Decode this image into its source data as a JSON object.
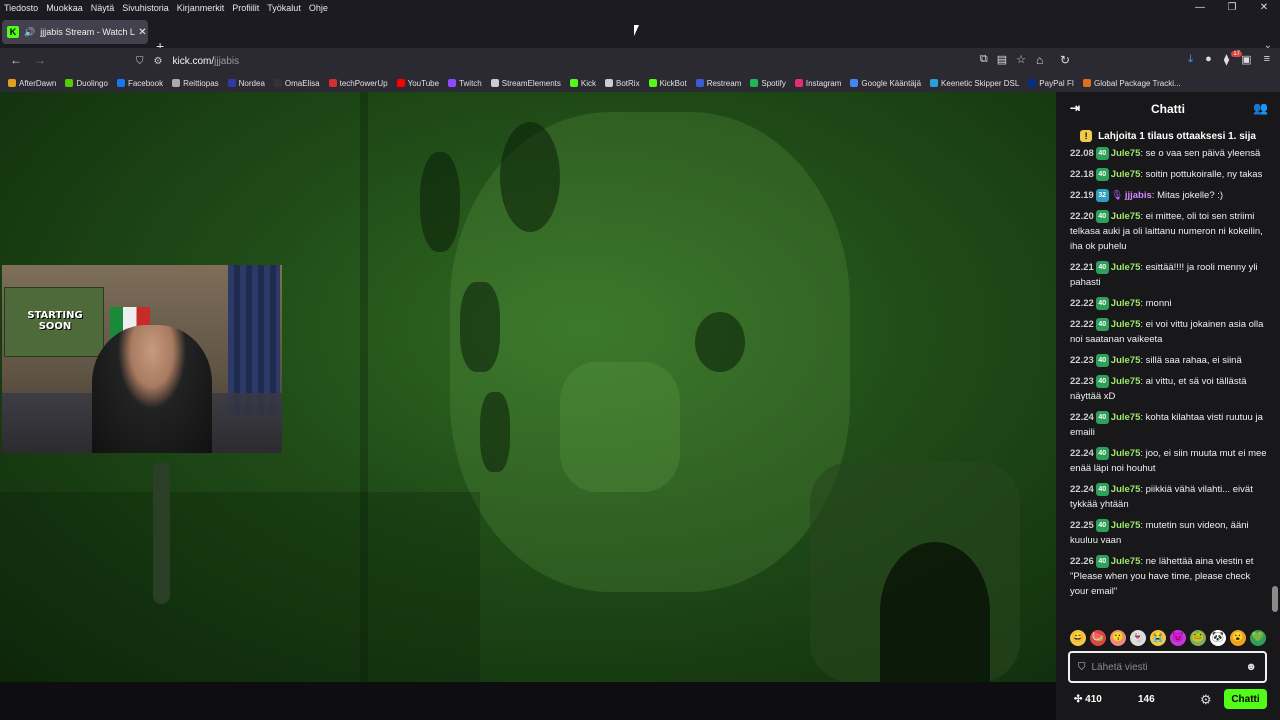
{
  "menubar": {
    "items": [
      "Tiedosto",
      "Muokkaa",
      "Näytä",
      "Sivuhistoria",
      "Kirjanmerkit",
      "Profiilit",
      "Työkalut",
      "Ohje"
    ]
  },
  "tab": {
    "title": "jjjabis Stream - Watch Live",
    "favicon": "K"
  },
  "url": {
    "host": "kick.com/",
    "path": "jjjabis"
  },
  "toolbar": {
    "extension_badge": "17"
  },
  "bookmarks": [
    {
      "label": "AfterDawn",
      "color": "#e0a020"
    },
    {
      "label": "Duolingo",
      "color": "#58cc02"
    },
    {
      "label": "Facebook",
      "color": "#1877f2"
    },
    {
      "label": "Reittiopas",
      "color": "#aaaaaa"
    },
    {
      "label": "Nordea",
      "color": "#2d3aa8"
    },
    {
      "label": "OmaElisa",
      "color": "#333333"
    },
    {
      "label": "techPowerUp",
      "color": "#d03030"
    },
    {
      "label": "YouTube",
      "color": "#ff0000"
    },
    {
      "label": "Twitch",
      "color": "#9146ff"
    },
    {
      "label": "StreamElements",
      "color": "#cccccc"
    },
    {
      "label": "Kick",
      "color": "#53fc18"
    },
    {
      "label": "BotRix",
      "color": "#cccccc"
    },
    {
      "label": "KickBot",
      "color": "#53fc18"
    },
    {
      "label": "Restream",
      "color": "#3a5bd8"
    },
    {
      "label": "Spotify",
      "color": "#1db954"
    },
    {
      "label": "Instagram",
      "color": "#e1306c"
    },
    {
      "label": "Google Kääntäjä",
      "color": "#4285f4"
    },
    {
      "label": "Keenetic Skipper DSL",
      "color": "#2aa0d8"
    },
    {
      "label": "PayPal FI",
      "color": "#003087"
    },
    {
      "label": "Global Package Tracki...",
      "color": "#e07020"
    }
  ],
  "cam": {
    "poster_text": "STARTING SOON"
  },
  "chat": {
    "title": "Chatti",
    "pinned": "Lahjoita 1 tilaus ottaaksesi 1. sija",
    "messages": [
      {
        "time": "22.08",
        "badge": "40",
        "user": "Jule75",
        "text": "se o vaa sen päivä yleensä"
      },
      {
        "time": "22.18",
        "badge": "40",
        "user": "Jule75",
        "text": "soitin pottukoiralle, ny takas"
      },
      {
        "time": "22.19",
        "badge": "32",
        "user": "jjjabis",
        "text": "Mitas jokelle? :)"
      },
      {
        "time": "22.20",
        "badge": "40",
        "user": "Jule75",
        "text": "ei mittee, oli toi sen striimi telkasa auki ja oli laittanu numeron ni kokeilin, iha ok puhelu"
      },
      {
        "time": "22.21",
        "badge": "40",
        "user": "Jule75",
        "text": "esittää!!!! ja rooli menny yli pahasti"
      },
      {
        "time": "22.22",
        "badge": "40",
        "user": "Jule75",
        "text": "monni"
      },
      {
        "time": "22.22",
        "badge": "40",
        "user": "Jule75",
        "text": "ei voi vittu jokainen asia olla noi saatanan vaikeeta"
      },
      {
        "time": "22.23",
        "badge": "40",
        "user": "Jule75",
        "text": "sillä saa rahaa, ei siinä"
      },
      {
        "time": "22.23",
        "badge": "40",
        "user": "Jule75",
        "text": "ai vittu, et sä voi tällästä näyttää xD"
      },
      {
        "time": "22.24",
        "badge": "40",
        "user": "Jule75",
        "text": "kohta kilahtaa visti ruutuu ja emaili"
      },
      {
        "time": "22.24",
        "badge": "40",
        "user": "Jule75",
        "text": "joo, ei siin muuta mut ei mee enää läpi noi houhut"
      },
      {
        "time": "22.24",
        "badge": "40",
        "user": "Jule75",
        "text": "piikkiä vähä vilahti... eivät tykkää yhtään"
      },
      {
        "time": "22.25",
        "badge": "40",
        "user": "Jule75",
        "text": "mutetin sun videon, ääni kuuluu vaan"
      },
      {
        "time": "22.26",
        "badge": "40",
        "user": "Jule75",
        "text": "ne lähettää aina viestin et \"Please when you have time, please check your email\""
      }
    ],
    "input_placeholder": "Lähetä viesti",
    "viewers": "410",
    "points": "146",
    "send_label": "Chatti"
  },
  "colors": {
    "kick_green": "#53fc18",
    "user_green": "#9fe86a",
    "streamer_purple": "#d389ff"
  }
}
